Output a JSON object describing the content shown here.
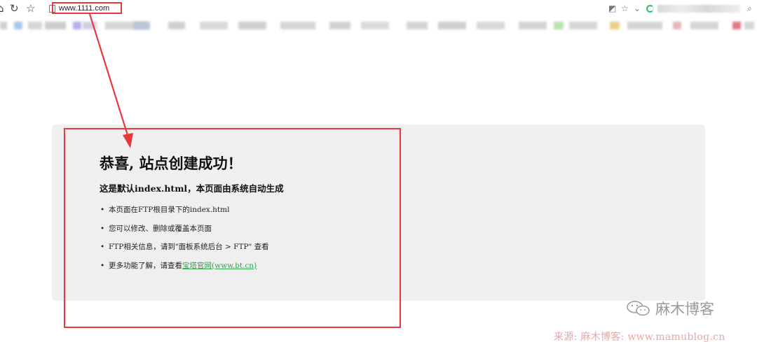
{
  "browser": {
    "url": "www.1111.com",
    "nav_icons": [
      "home-icon",
      "refresh-icon",
      "star-icon"
    ],
    "right_icons": [
      "screenshot-icon",
      "favorite-icon",
      "chevron-down-icon",
      "search-icon"
    ]
  },
  "colors": {
    "annotation_red": "#e8383d",
    "panel_bg": "#efefef",
    "link_green": "#2fa34a",
    "watermark_pink": "#e8a6a6"
  },
  "page": {
    "title": "恭喜, 站点创建成功！",
    "subtitle": "这是默认index.html，本页面由系统自动生成",
    "items": [
      {
        "text": "本页面在FTP根目录下的index.html"
      },
      {
        "text": "您可以修改、删除或覆盖本页面"
      },
      {
        "text": "FTP相关信息，请到\"面板系统后台 > FTP\" 查看"
      },
      {
        "text": "更多功能了解，请查看",
        "link": "宝塔官网(www.bt.cn)"
      }
    ]
  },
  "watermark": {
    "name": "麻木博客",
    "source": "来源: 麻木博客: www.mamublog.cn"
  }
}
